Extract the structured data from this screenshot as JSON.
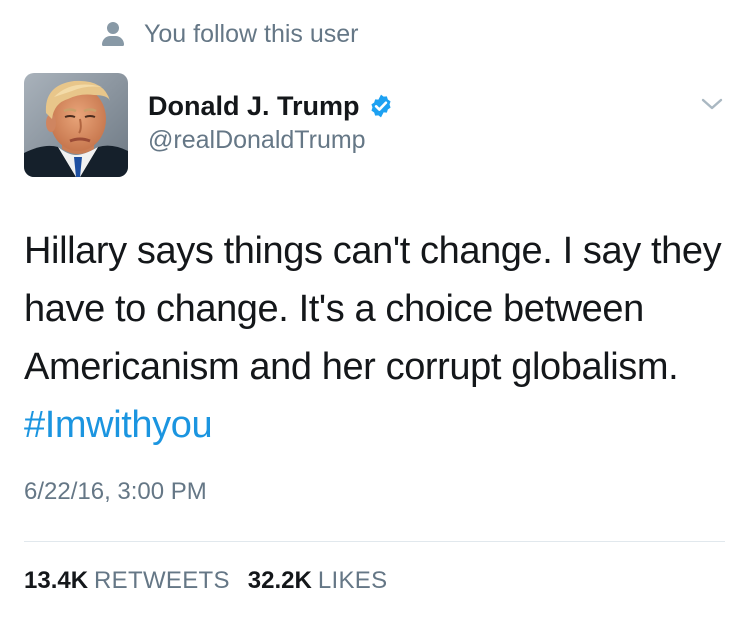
{
  "social_context": {
    "text": "You follow this user",
    "icon": "person-icon"
  },
  "author": {
    "display_name": "Donald J. Trump",
    "handle": "@realDonaldTrump",
    "verified": true,
    "verified_color": "#1da1f2"
  },
  "tweet": {
    "text_parts": [
      "Hillary says things can't change. I say they have to change. It's a choice between Americanism and her corrupt globalism. ",
      "#Imwithyou"
    ],
    "hashtag_color": "#1b95e0",
    "timestamp": "6/22/16, 3:00 PM"
  },
  "stats": {
    "retweets_count": "13.4K",
    "retweets_label": "RETWEETS",
    "likes_count": "32.2K",
    "likes_label": "LIKES"
  }
}
